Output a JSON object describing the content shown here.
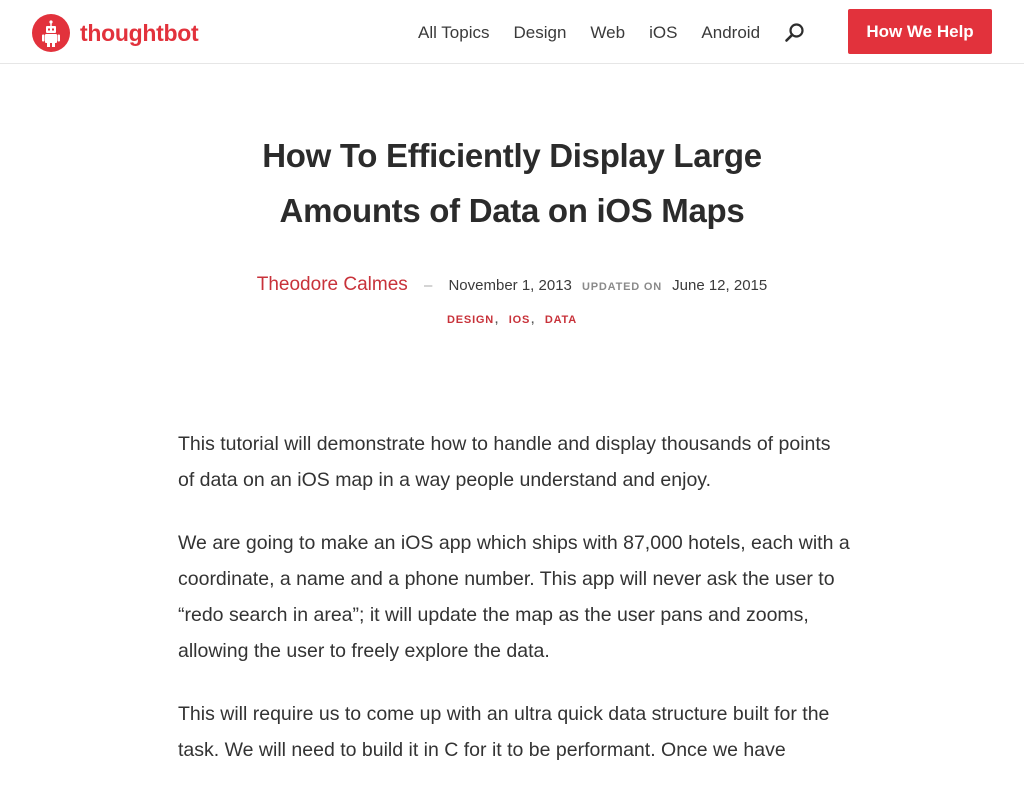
{
  "header": {
    "logo_text": "thoughtbot",
    "nav": [
      "All Topics",
      "Design",
      "Web",
      "iOS",
      "Android"
    ],
    "search_icon": "search-icon",
    "cta_label": "How We Help",
    "accent": "#e2323c"
  },
  "article": {
    "title": "How To Efficiently Display Large Amounts of Data on iOS Maps",
    "author": "Theodore Calmes",
    "dash": "–",
    "published": "November 1, 2013",
    "updated_label": "UPDATED ON",
    "updated": "June 12, 2015",
    "tags": [
      "DESIGN",
      "IOS",
      "DATA"
    ],
    "paragraphs": [
      "This tutorial will demonstrate how to handle and display thousands of points of data on an iOS map in a way people understand and enjoy.",
      "We are going to make an iOS app which ships with 87,000 hotels, each with a coordinate, a name and a phone number. This app will never ask the user to “redo search in area”; it will update the map as the user pans and zooms, allowing the user to freely explore the data.",
      "This will require us to come up with an ultra quick data structure built for the task. We will need to build it in C for it to be performant. Once we have"
    ]
  }
}
